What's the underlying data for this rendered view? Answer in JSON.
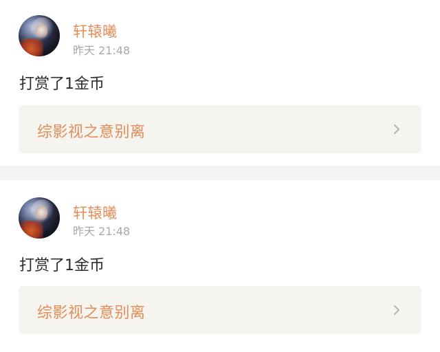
{
  "feed": {
    "items": [
      {
        "user": {
          "name": "轩辕曦"
        },
        "time": "昨天 21:48",
        "action": "打赏了1金币",
        "book_card": {
          "title": "综影视之意别离"
        }
      },
      {
        "user": {
          "name": "轩辕曦"
        },
        "time": "昨天 21:48",
        "action": "打赏了1金币",
        "book_card": {
          "title": "综影视之意别离"
        }
      }
    ]
  },
  "colors": {
    "accent": "#e28d5a",
    "text_primary": "#2c2c2c",
    "text_secondary": "#a8a8a8",
    "card_bg": "#f6f4ee",
    "separator_bg": "#f4f3f2"
  },
  "icons": {
    "avatar": "avatar",
    "chevron": "chevron-right-icon"
  }
}
